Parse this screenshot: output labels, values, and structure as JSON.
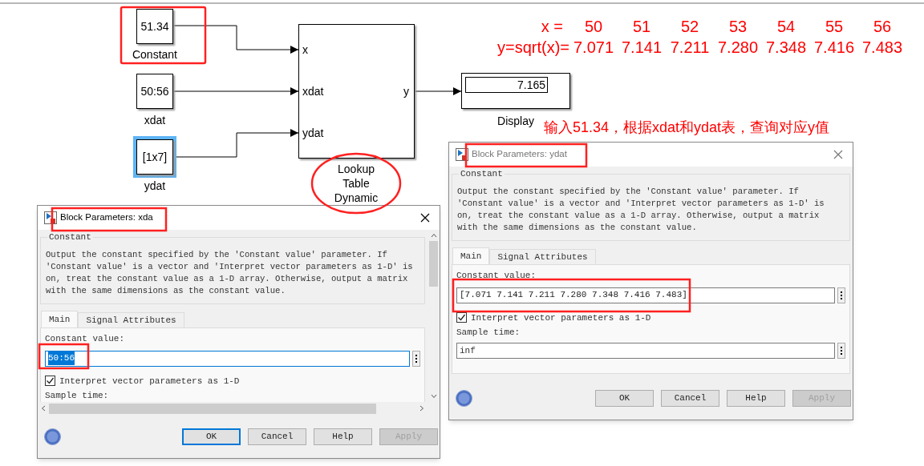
{
  "blocks": [
    {
      "kind": "constant",
      "value": "51.34",
      "label": "Constant",
      "selected": false
    },
    {
      "kind": "constant",
      "value": "50:56",
      "label": "xdat",
      "selected": false
    },
    {
      "kind": "constant",
      "value": "[1x7]",
      "label": "ydat",
      "selected": true
    }
  ],
  "lookup": {
    "inputs": [
      "x",
      "xdat",
      "ydat"
    ],
    "output": "y",
    "label_lines": [
      "Lookup",
      "Table",
      "Dynamic"
    ]
  },
  "display": {
    "value": "7.165",
    "label": "Display"
  },
  "notes": {
    "x_label": "x =",
    "x_values": [
      "50",
      "51",
      "52",
      "53",
      "54",
      "55",
      "56"
    ],
    "y_label": "y=sqrt(x)=",
    "y_values": [
      "7.071",
      "7.141",
      "7.211",
      "7.280",
      "7.348",
      "7.416",
      "7.483"
    ],
    "caption": "输入51.34，根据xdat和ydat表，查询对应y值"
  },
  "dialogs": [
    {
      "title": "Block Parameters: xda",
      "active": true,
      "group": "Constant",
      "description": "Output the constant specified by the 'Constant value' parameter. If 'Constant value' is a vector and 'Interpret vector parameters as 1-D' is on, treat the constant value as a 1-D array. Otherwise, output a matrix with the same dimensions as the constant value.",
      "tabs": [
        {
          "label": "Main",
          "selected": true
        },
        {
          "label": "Signal Attributes",
          "selected": false
        }
      ],
      "value_label": "Constant value:",
      "value": "50:56",
      "value_selected": true,
      "checkbox": {
        "label": "Interpret vector parameters as 1-D",
        "checked": true
      },
      "sample_label": "Sample time:",
      "scrollbars": true,
      "buttons": [
        {
          "label": "OK",
          "focused": true,
          "disabled": false
        },
        {
          "label": "Cancel",
          "focused": false,
          "disabled": false
        },
        {
          "label": "Help",
          "focused": false,
          "disabled": false
        },
        {
          "label": "Apply",
          "focused": false,
          "disabled": true
        }
      ]
    },
    {
      "title": "Block Parameters: ydat",
      "active": false,
      "group": "Constant",
      "description": "Output the constant specified by the 'Constant value' parameter. If 'Constant value' is a vector and 'Interpret vector parameters as 1-D' is on, treat the constant value as a 1-D array. Otherwise, output a matrix with the same dimensions as the constant value.",
      "tabs": [
        {
          "label": "Main",
          "selected": true
        },
        {
          "label": "Signal Attributes",
          "selected": false
        }
      ],
      "value_label": "Constant value:",
      "value": "[7.071 7.141 7.211 7.280 7.348 7.416 7.483]",
      "value_selected": false,
      "checkbox": {
        "label": "Interpret vector parameters as 1-D",
        "checked": true
      },
      "sample_label": "Sample time:",
      "sample_value": "inf",
      "scrollbars": false,
      "buttons": [
        {
          "label": "OK",
          "focused": false,
          "disabled": false
        },
        {
          "label": "Cancel",
          "focused": false,
          "disabled": false
        },
        {
          "label": "Help",
          "focused": false,
          "disabled": false
        },
        {
          "label": "Apply",
          "focused": false,
          "disabled": true
        }
      ]
    }
  ]
}
